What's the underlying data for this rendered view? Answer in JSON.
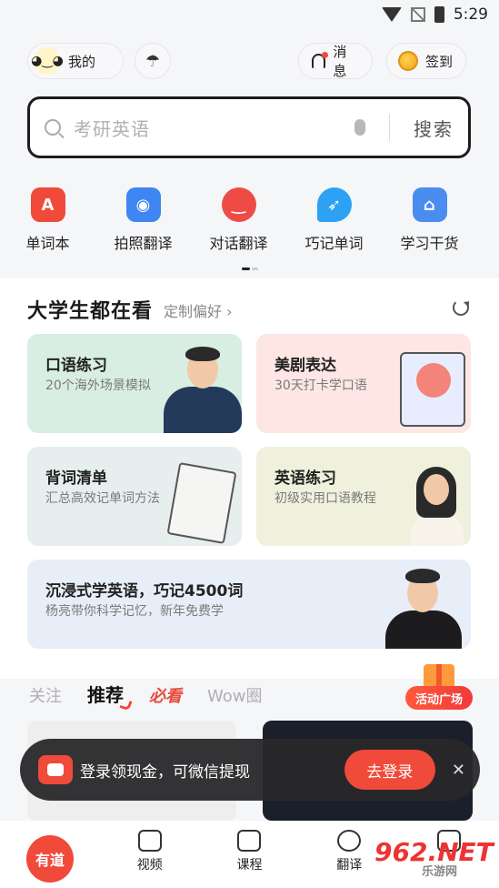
{
  "status_bar": {
    "time": "5:29"
  },
  "top_bar": {
    "profile_label": "我的",
    "messages_label": "消息",
    "checkin_label": "签到"
  },
  "search": {
    "placeholder": "考研英语",
    "button_label": "搜索"
  },
  "tools": [
    {
      "label": "单词本",
      "icon": "wordbook-icon",
      "color": "#f04a3a"
    },
    {
      "label": "拍照翻译",
      "icon": "camera-icon",
      "color": "#3f86f2"
    },
    {
      "label": "对话翻译",
      "icon": "chat-icon",
      "color": "#ef4b46"
    },
    {
      "label": "巧记单词",
      "icon": "rocket-icon",
      "color": "#2da1f4"
    },
    {
      "label": "学习干货",
      "icon": "bookmark-icon",
      "color": "#4a8cf0"
    }
  ],
  "section": {
    "title": "大学生都在看",
    "link": "定制偏好 ›"
  },
  "cards": [
    {
      "title": "口语练习",
      "subtitle": "20个海外场景模拟",
      "bg": "#d8eee2"
    },
    {
      "title": "美剧表达",
      "subtitle": "30天打卡学口语",
      "bg": "#fde6e4"
    },
    {
      "title": "背词清单",
      "subtitle": "汇总高效记单词方法",
      "bg": "#e6eeee"
    },
    {
      "title": "英语练习",
      "subtitle": "初级实用口语教程",
      "bg": "#f0f1dc"
    },
    {
      "title": "沉浸式学英语，巧记4500词",
      "subtitle": "杨亮带你科学记忆，新年免费学",
      "bg": "#e8eef8"
    }
  ],
  "feed_tabs": {
    "follow": "关注",
    "recommend": "推荐",
    "must_see": "必看",
    "wow": "Wow圈"
  },
  "activity_label": "活动广场",
  "toast": {
    "message": "登录领现金，可微信提现",
    "cta": "去登录"
  },
  "nav": {
    "home": "有道",
    "video": "视频",
    "course": "课程",
    "translate": "翻译"
  },
  "watermark": {
    "brand": "962.NET",
    "sub": "乐游网"
  }
}
